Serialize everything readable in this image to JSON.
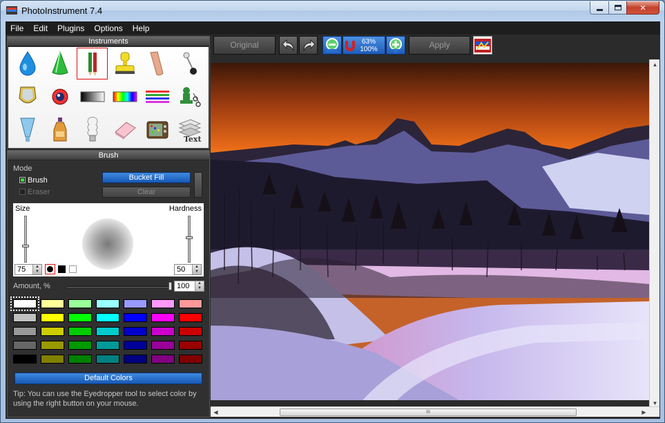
{
  "window": {
    "title": "PhotoInstrument 7.4"
  },
  "menu": [
    "File",
    "Edit",
    "Plugins",
    "Options",
    "Help"
  ],
  "instruments": {
    "header": "Instruments",
    "tools": [
      {
        "name": "water-drop-icon"
      },
      {
        "name": "cone-icon"
      },
      {
        "name": "pencils-icon",
        "selected": true
      },
      {
        "name": "stamp-icon"
      },
      {
        "name": "skin-tone-icon"
      },
      {
        "name": "pin-icon"
      },
      {
        "name": "shield-icon"
      },
      {
        "name": "red-eye-icon"
      },
      {
        "name": "gradient-icon"
      },
      {
        "name": "spectrum-icon"
      },
      {
        "name": "color-lines-icon"
      },
      {
        "name": "clone-cut-icon"
      },
      {
        "name": "funnel-icon"
      },
      {
        "name": "bottle-icon"
      },
      {
        "name": "bulb-icon"
      },
      {
        "name": "eraser-icon"
      },
      {
        "name": "tv-noise-icon"
      },
      {
        "name": "text-layers-icon"
      }
    ]
  },
  "brush": {
    "header": "Brush",
    "mode_label": "Mode",
    "brush_label": "Brush",
    "eraser_label": "Eraser",
    "bucket_fill": "Bucket Fill",
    "clear": "Clear",
    "size_label": "Size",
    "hardness_label": "Hardness",
    "size_value": "75",
    "hardness_value": "50",
    "amount_label": "Amount, %",
    "amount_value": "100",
    "default_colors": "Default Colors",
    "tip": "Tip: You can use the Eyedropper tool to select color by using the right button on your mouse.",
    "swatches": [
      "#ffffff",
      "#ffff99",
      "#99ff99",
      "#99ffff",
      "#9999ff",
      "#ff99ff",
      "#ff9999",
      "#c0c0c0",
      "#ffff00",
      "#00ff00",
      "#00ffff",
      "#0000ff",
      "#ff00ff",
      "#ff0000",
      "#999999",
      "#cccc00",
      "#00cc00",
      "#00cccc",
      "#0000cc",
      "#cc00cc",
      "#cc0000",
      "#666666",
      "#999900",
      "#009900",
      "#009999",
      "#000099",
      "#990099",
      "#990000",
      "#000000",
      "#808000",
      "#008000",
      "#008080",
      "#000080",
      "#800080",
      "#800000"
    ]
  },
  "toolbar": {
    "original": "Original",
    "apply": "Apply",
    "zoom_top": "63%",
    "zoom_bottom": "100%"
  },
  "hscroll_grip": "III"
}
